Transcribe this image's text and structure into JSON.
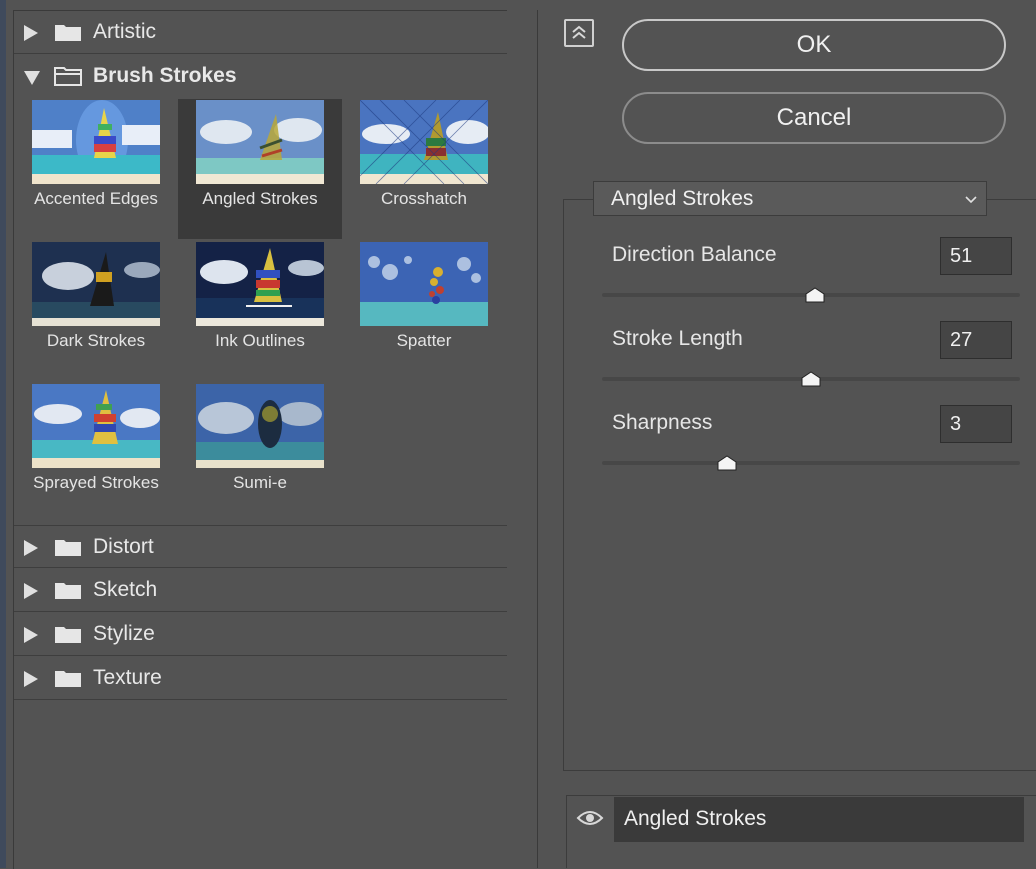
{
  "categories_top": [
    {
      "label": "Artistic",
      "expanded": false
    },
    {
      "label": "Brush Strokes",
      "expanded": true
    }
  ],
  "thumbnails": [
    {
      "label": "Accented Edges",
      "selected": false
    },
    {
      "label": "Angled Strokes",
      "selected": true
    },
    {
      "label": "Crosshatch",
      "selected": false
    },
    {
      "label": "Dark Strokes",
      "selected": false
    },
    {
      "label": "Ink Outlines",
      "selected": false
    },
    {
      "label": "Spatter",
      "selected": false
    },
    {
      "label": "Sprayed Strokes",
      "selected": false
    },
    {
      "label": "Sumi-e",
      "selected": false
    }
  ],
  "categories_bottom": [
    {
      "label": "Distort"
    },
    {
      "label": "Sketch"
    },
    {
      "label": "Stylize"
    },
    {
      "label": "Texture"
    }
  ],
  "buttons": {
    "ok": "OK",
    "cancel": "Cancel"
  },
  "filter_select": {
    "value": "Angled Strokes"
  },
  "params": [
    {
      "label": "Direction Balance",
      "value": "51",
      "fraction": 0.51
    },
    {
      "label": "Stroke Length",
      "value": "27",
      "fraction": 0.5
    },
    {
      "label": "Sharpness",
      "value": "3",
      "fraction": 0.3
    }
  ],
  "layer": {
    "name": "Angled Strokes",
    "icon": "eye-icon"
  }
}
